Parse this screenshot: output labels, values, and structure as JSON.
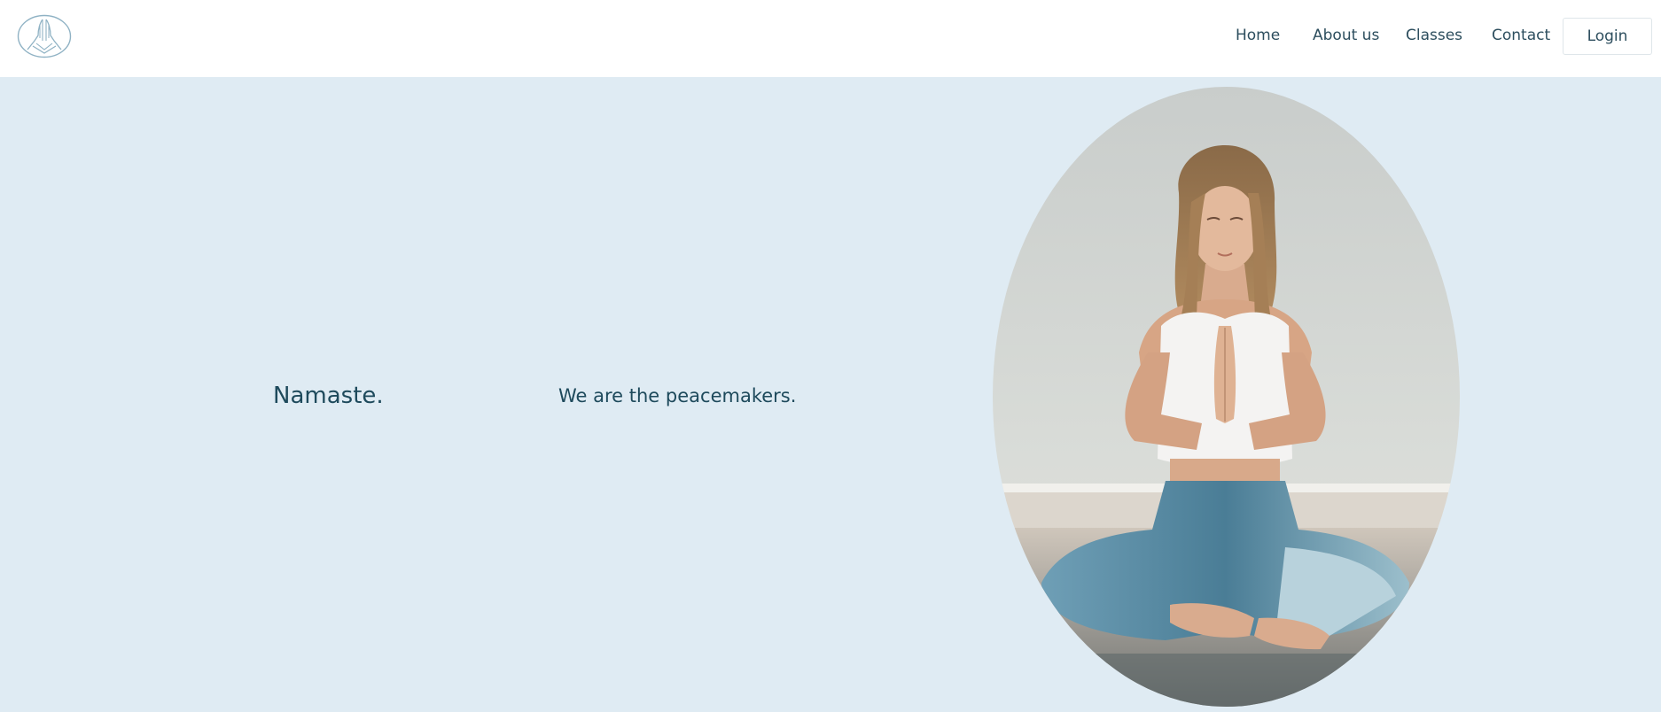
{
  "header": {
    "logo_icon": "praying-hands-icon",
    "nav": [
      {
        "label": "Home"
      },
      {
        "label": "About us"
      },
      {
        "label": "Classes"
      },
      {
        "label": "Contact"
      }
    ],
    "login_label": "Login"
  },
  "hero": {
    "title": "Namaste.",
    "tagline": "We are the peacemakers.",
    "image_subject": "woman-meditating-photo"
  },
  "colors": {
    "hero_background": "#dfebf3",
    "text_primary": "#1e4a5c",
    "logo_stroke": "#8fb2c4"
  }
}
